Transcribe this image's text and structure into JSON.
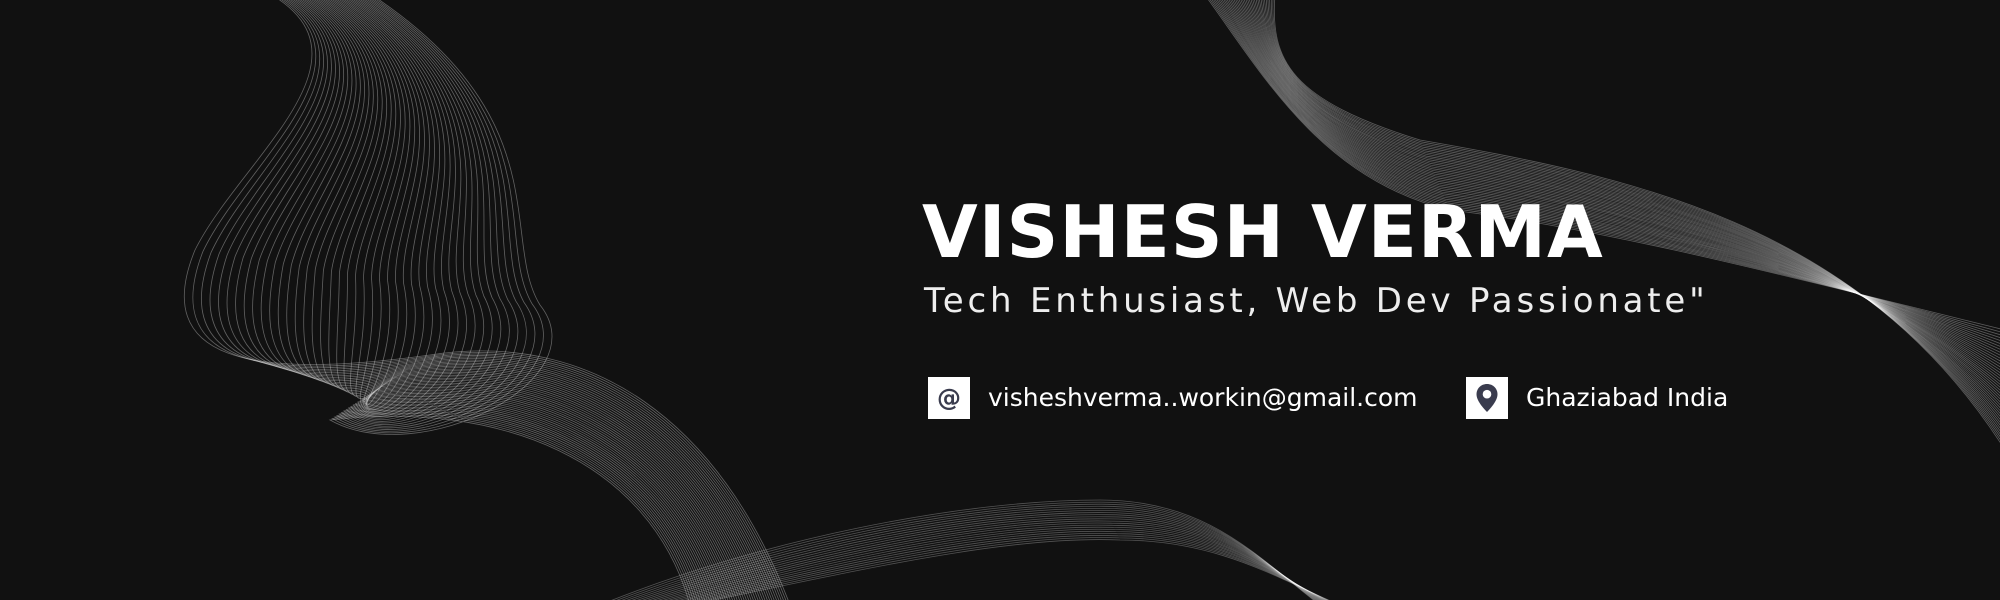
{
  "banner": {
    "name": "VISHESH VERMA",
    "tagline": "Tech Enthusiast, Web Dev Passionate\"",
    "email": "visheshverma..workin@gmail.com",
    "location": "Ghaziabad India",
    "email_icon": "at-sign-icon",
    "location_icon": "map-pin-icon"
  },
  "colors": {
    "background": "#111111",
    "text": "#ffffff",
    "icon_box": "#ffffff",
    "icon_glyph": "#3a3c4e",
    "wave_lines": "#ffffff"
  }
}
